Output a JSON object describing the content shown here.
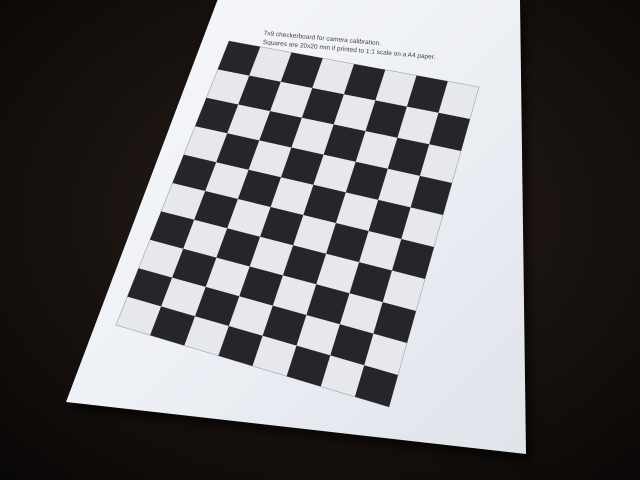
{
  "photo": {
    "subject": "printed checkerboard calibration sheet on a desk"
  },
  "paper": {
    "caption_line_1": "7x9 checkerboard for camera calibration.",
    "caption_line_2": "Squares are 20x20 mm if printed to 1:1 scale on a A4 paper."
  },
  "checkerboard": {
    "columns": 7,
    "rows": 9,
    "square_mm": 20
  },
  "colors": {
    "desk": "#120d0b",
    "paper": "#eef0f5",
    "square_dark": "#25252a",
    "square_light": "#e6e8ee"
  }
}
